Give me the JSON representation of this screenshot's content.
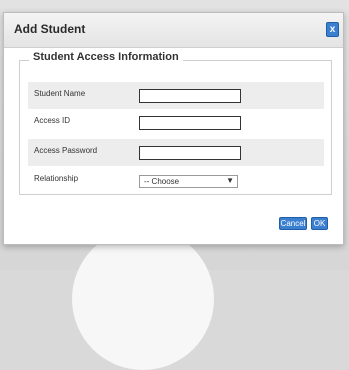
{
  "dialog": {
    "title": "Add Student",
    "close_label": "x"
  },
  "section": {
    "legend": "Student Access Information"
  },
  "form": {
    "rows": [
      {
        "label": "Student Name",
        "value": ""
      },
      {
        "label": "Access ID",
        "value": ""
      },
      {
        "label": "Access Password",
        "value": ""
      },
      {
        "label": "Relationship",
        "selected": "-- Choose"
      }
    ]
  },
  "buttons": {
    "cancel_label": "Cancel",
    "ok_label": "OK"
  },
  "icons": {
    "close": "close-icon",
    "dropdown": "chevron-down-icon"
  },
  "colors": {
    "accent": "#3a7fd0",
    "row_shade": "#ededed"
  }
}
